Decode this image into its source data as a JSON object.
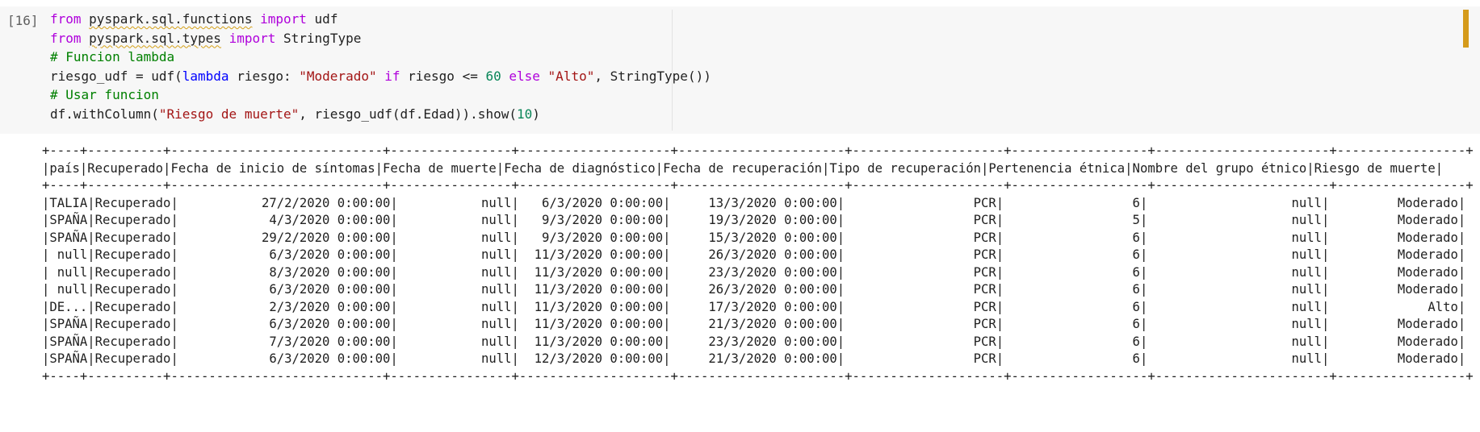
{
  "cell": {
    "prompt": "[16]",
    "code": {
      "line1": {
        "kw_from": "from",
        "module": "pyspark.sql.functions",
        "kw_import": "import",
        "name": "udf"
      },
      "line2": {
        "kw_from": "from",
        "module": "pyspark.sql.types",
        "kw_import": "import",
        "name": "StringType"
      },
      "line3": {
        "comment": "# Funcion lambda"
      },
      "line4": {
        "p1": "riesgo_udf = udf(",
        "kw_lambda": "lambda",
        "p2": " riesgo: ",
        "s1": "\"Moderado\"",
        "kw_if": "if",
        "p3": " riesgo <= ",
        "n1": "60",
        "kw_else": "else",
        "s2": "\"Alto\"",
        "p4": ", StringType())"
      },
      "line5": {
        "comment": "# Usar funcion"
      },
      "line6": {
        "p1": "df.withColumn(",
        "s1": "\"Riesgo de muerte\"",
        "p2": ", riesgo_udf(df.Edad)).show(",
        "n1": "10",
        "p3": ")"
      }
    }
  },
  "output": {
    "separator": "+----+----------+----------------------------+----------------+--------------------+----------------------+--------------------+------------------+-----------------------+-----------------+",
    "header": "|país|Recuperado|Fecha de inicio de síntomas|Fecha de muerte|Fecha de diagnóstico|Fecha de recuperación|Tipo de recuperación|Pertenencia étnica|Nombre del grupo étnico|Riesgo de muerte|",
    "rows": [
      "|TALIA|Recuperado|           27/2/2020 0:00:00|           null|   6/3/2020 0:00:00|     13/3/2020 0:00:00|                 PCR|                 6|                   null|         Moderado|",
      "|SPAÑA|Recuperado|            4/3/2020 0:00:00|           null|   9/3/2020 0:00:00|     19/3/2020 0:00:00|                 PCR|                 5|                   null|         Moderado|",
      "|SPAÑA|Recuperado|           29/2/2020 0:00:00|           null|   9/3/2020 0:00:00|     15/3/2020 0:00:00|                 PCR|                 6|                   null|         Moderado|",
      "| null|Recuperado|            6/3/2020 0:00:00|           null|  11/3/2020 0:00:00|     26/3/2020 0:00:00|                 PCR|                 6|                   null|         Moderado|",
      "| null|Recuperado|            8/3/2020 0:00:00|           null|  11/3/2020 0:00:00|     23/3/2020 0:00:00|                 PCR|                 6|                   null|         Moderado|",
      "| null|Recuperado|            6/3/2020 0:00:00|           null|  11/3/2020 0:00:00|     26/3/2020 0:00:00|                 PCR|                 6|                   null|         Moderado|",
      "|DE...|Recuperado|            2/3/2020 0:00:00|           null|  11/3/2020 0:00:00|     17/3/2020 0:00:00|                 PCR|                 6|                   null|             Alto|",
      "|SPAÑA|Recuperado|            6/3/2020 0:00:00|           null|  11/3/2020 0:00:00|     21/3/2020 0:00:00|                 PCR|                 6|                   null|         Moderado|",
      "|SPAÑA|Recuperado|            7/3/2020 0:00:00|           null|  11/3/2020 0:00:00|     23/3/2020 0:00:00|                 PCR|                 6|                   null|         Moderado|",
      "|SPAÑA|Recuperado|            6/3/2020 0:00:00|           null|  12/3/2020 0:00:00|     21/3/2020 0:00:00|                 PCR|                 6|                   null|         Moderado|"
    ]
  }
}
